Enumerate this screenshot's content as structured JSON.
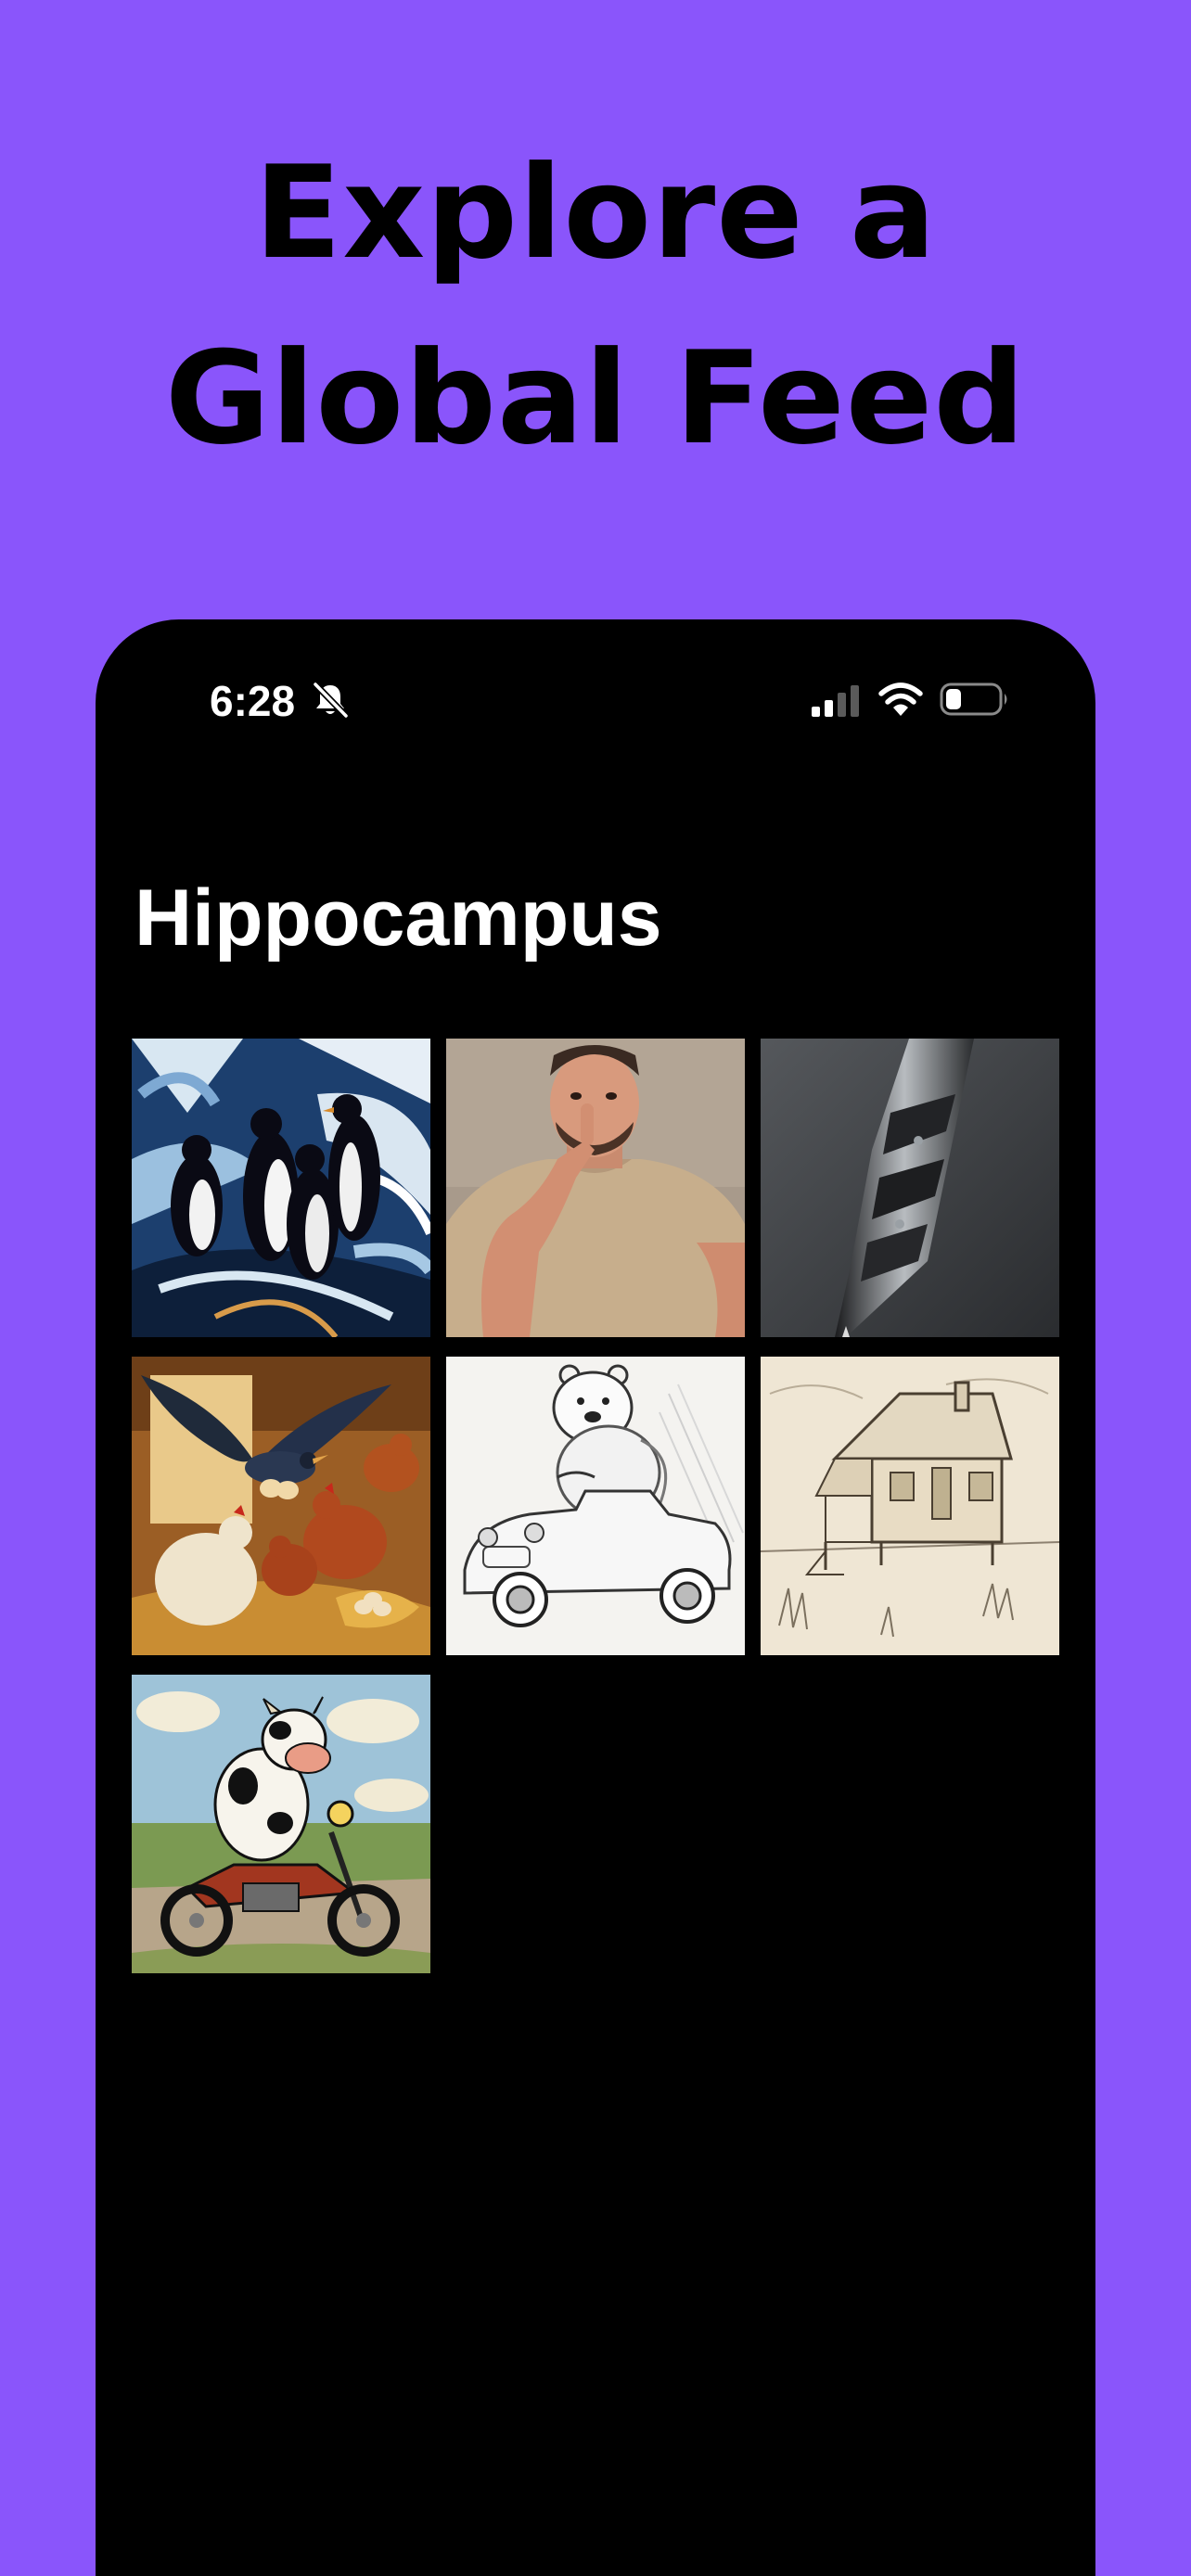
{
  "marketing": {
    "headline_line1": "Explore a",
    "headline_line2": "Global Feed"
  },
  "status_bar": {
    "time": "6:28",
    "icons": [
      "bell-slash-icon",
      "cellular-signal-icon",
      "wifi-icon",
      "battery-icon"
    ]
  },
  "feed": {
    "title": "Hippocampus",
    "images": [
      {
        "name": "penguins-painting",
        "alt": "penguins painting"
      },
      {
        "name": "man-picking-nose-photo",
        "alt": "man picking nose"
      },
      {
        "name": "metal-pen-photo",
        "alt": "metal pen"
      },
      {
        "name": "bird-stealing-eggs-illustration",
        "alt": "bird and chickens"
      },
      {
        "name": "bear-driving-car-sketch",
        "alt": "bear driving car"
      },
      {
        "name": "beach-house-sketch",
        "alt": "beach house"
      },
      {
        "name": "cow-on-motorcycle-illustration",
        "alt": "cow on motorcycle"
      }
    ]
  },
  "colors": {
    "background": "#8a55fb",
    "phone": "#000000",
    "text_light": "#ffffff"
  }
}
